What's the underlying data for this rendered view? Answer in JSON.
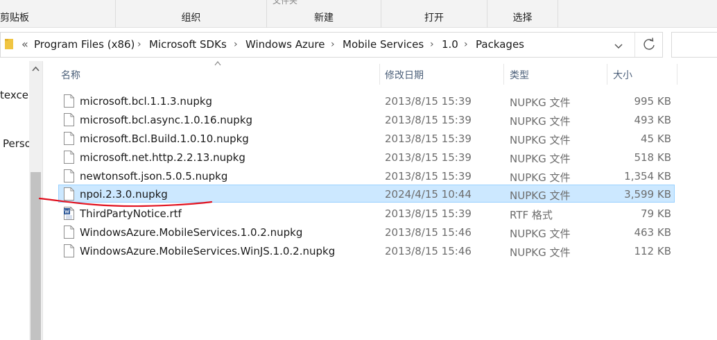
{
  "ribbon": {
    "groups": [
      {
        "label": "剪贴板"
      },
      {
        "label": "组织"
      },
      {
        "label": "新建"
      },
      {
        "label": "打开"
      },
      {
        "label": "选择"
      }
    ],
    "cut_text": "文件夹"
  },
  "address": {
    "overflow": "«",
    "crumbs": [
      "Program Files (x86)",
      "Microsoft SDKs",
      "Windows Azure",
      "Mobile Services",
      "1.0",
      "Packages"
    ]
  },
  "nav": {
    "items": [
      "texcel",
      "Perso"
    ]
  },
  "columns": {
    "name": "名称",
    "date": "修改日期",
    "type": "类型",
    "size": "大小"
  },
  "files": [
    {
      "name": "microsoft.bcl.1.1.3.nupkg",
      "date": "2013/8/15 15:39",
      "type": "NUPKG 文件",
      "size": "995 KB",
      "icon": "file-icon"
    },
    {
      "name": "microsoft.bcl.async.1.0.16.nupkg",
      "date": "2013/8/15 15:39",
      "type": "NUPKG 文件",
      "size": "493 KB",
      "icon": "file-icon"
    },
    {
      "name": "microsoft.Bcl.Build.1.0.10.nupkg",
      "date": "2013/8/15 15:39",
      "type": "NUPKG 文件",
      "size": "45 KB",
      "icon": "file-icon"
    },
    {
      "name": "microsoft.net.http.2.2.13.nupkg",
      "date": "2013/8/15 15:39",
      "type": "NUPKG 文件",
      "size": "518 KB",
      "icon": "file-icon"
    },
    {
      "name": "newtonsoft.json.5.0.5.nupkg",
      "date": "2013/8/15 15:39",
      "type": "NUPKG 文件",
      "size": "1,354 KB",
      "icon": "file-icon"
    },
    {
      "name": "npoi.2.3.0.nupkg",
      "date": "2024/4/15 10:44",
      "type": "NUPKG 文件",
      "size": "3,599 KB",
      "icon": "file-icon",
      "selected": true
    },
    {
      "name": "ThirdPartyNotice.rtf",
      "date": "2013/8/15 15:39",
      "type": "RTF 格式",
      "size": "79 KB",
      "icon": "word-doc-icon"
    },
    {
      "name": "WindowsAzure.MobileServices.1.0.2.nupkg",
      "date": "2013/8/15 15:46",
      "type": "NUPKG 文件",
      "size": "463 KB",
      "icon": "file-icon"
    },
    {
      "name": "WindowsAzure.MobileServices.WinJS.1.0.2.nupkg",
      "date": "2013/8/15 15:46",
      "type": "NUPKG 文件",
      "size": "112 KB",
      "icon": "file-icon"
    }
  ],
  "colors": {
    "selection_bg": "#cce8ff",
    "selection_border": "#99d1ff",
    "annotation": "#e0101e",
    "header_text": "#4c607a"
  }
}
